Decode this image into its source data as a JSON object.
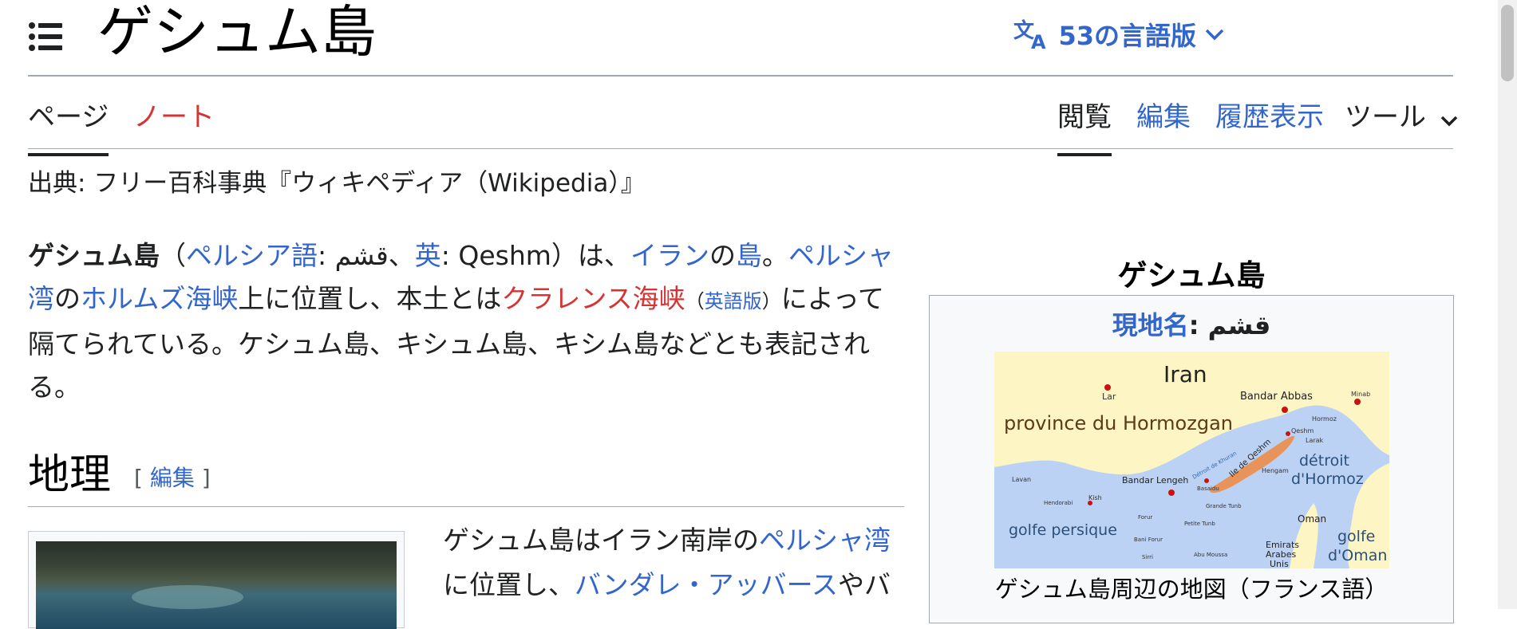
{
  "header": {
    "title": "ゲシュム島",
    "languages_label": "53の言語版",
    "menu_icon": "hamburger-menu-icon",
    "translate_icon": "translate-icon"
  },
  "tabs": {
    "page": "ページ",
    "talk": "ノート",
    "read": "閲覧",
    "edit": "編集",
    "history": "履歴表示",
    "tools": "ツール"
  },
  "from_line": "出典: フリー百科事典『ウィキペディア（Wikipedia）』",
  "lead": {
    "subject": "ゲシュム島",
    "paren_open": "（",
    "persian_link": "ペルシア語",
    "persian_text": ": قشم、",
    "en_link": "英",
    "en_text": ": Qeshm）は、",
    "iran_link": "イラン",
    "no": "の",
    "island_link": "島",
    "period": "。",
    "gulf_link": "ペルシャ湾",
    "no2": "の",
    "hormuz_link": "ホルムズ海峡",
    "t1": "上に位置し、本土とは",
    "clarence_link": "クラレンス海峡",
    "en_version_open": "（",
    "en_version_link": "英語版",
    "en_version_close": "）",
    "t2": "によって隔てられている。ケシュム島、キシュム島、キシム島などとも表記される。"
  },
  "section": {
    "title": "地理",
    "edit_open": "[ ",
    "edit_label": "編集",
    "edit_close": " ]"
  },
  "geo_para": {
    "t1": "ゲシュム島はイラン南岸の",
    "gulf_link": "ペルシャ湾",
    "t2": "に位置し、",
    "bandar_link": "バンダレ・アッバース",
    "t3": "やバ"
  },
  "infobox": {
    "title": "ゲシュム島",
    "local_name_label": "現地名",
    "local_name_colon": ": ",
    "local_name_value": "قشم",
    "caption": "ゲシュム島周辺の地図（フランス語）",
    "map_labels": {
      "iran": "Iran",
      "province": "province du Hormozgan",
      "lar": "Lar",
      "bandar_abbas": "Bandar Abbas",
      "minab": "Minab",
      "qeshm": "Qeshm",
      "ile": "Ile de Qeshm",
      "bandar_lengeh": "Bandar Lengeh",
      "detroit": "détroit",
      "hormoz": "d'Hormoz",
      "golfe_persique": "golfe persique",
      "kish": "Kish",
      "oman": "Oman",
      "golfe": "golfe",
      "doman": "d'Oman",
      "emirats": "Emirats",
      "arabes": "Arabes",
      "unis": "Unis",
      "lavan": "Lavan",
      "hendorabi": "Hendorabi",
      "hengam": "Hengam",
      "larak": "Larak",
      "hormoz_island": "Hormoz",
      "grande_tunb": "Grande Tunb",
      "petite_tunb": "Petite Tunb",
      "forur": "Forur",
      "bani_forur": "Bani Forur",
      "sirri": "Sirri",
      "abu_moussa": "Abu Moussa",
      "basaidu": "Basaidu",
      "khuran": "Détroit de Khuran"
    }
  },
  "colors": {
    "link": "#3366cc",
    "redlink": "#d73333",
    "text": "#202122",
    "map_land": "#fdf5c3",
    "map_sea": "#bcd2f5",
    "map_island": "#e8935a"
  }
}
